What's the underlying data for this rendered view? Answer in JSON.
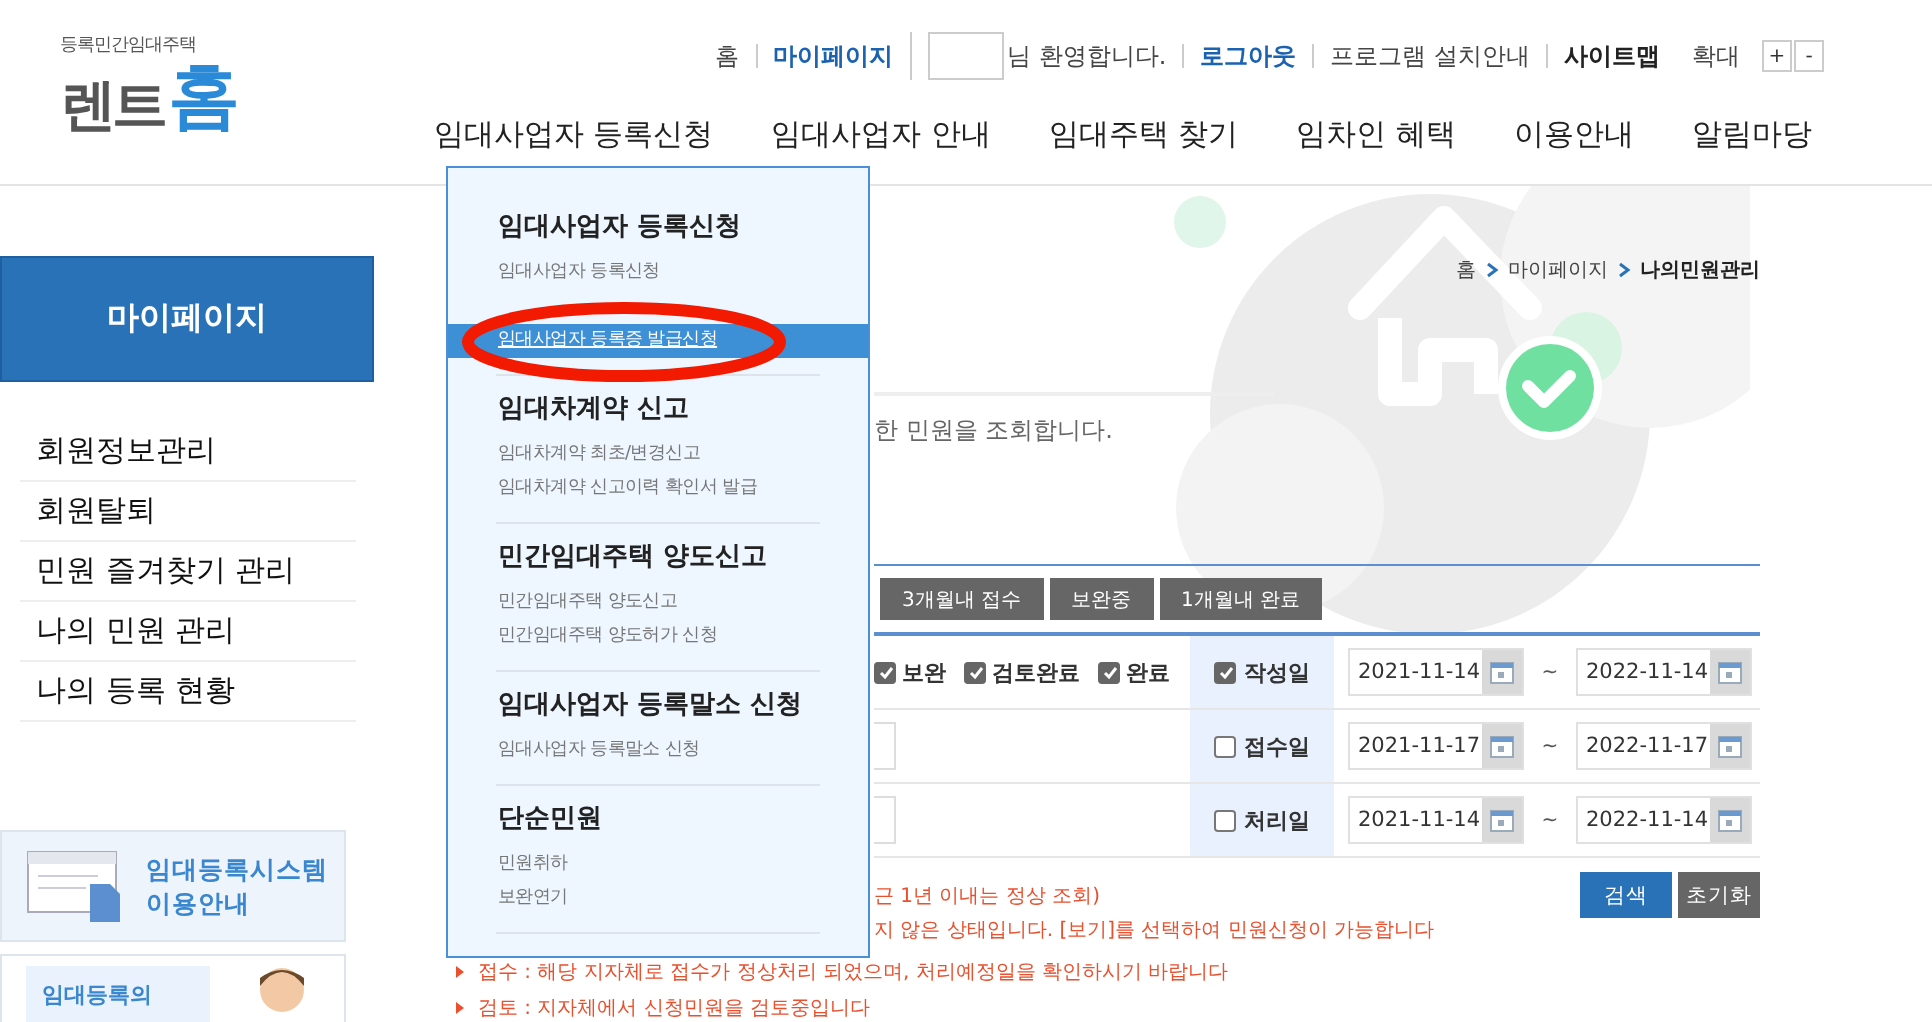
{
  "header": {
    "logo": {
      "subtitle": "등록민간임대주택",
      "name_main": "렌트",
      "name_accent": "홈"
    },
    "utility_links": [
      {
        "label": "홈",
        "kind": "plain"
      },
      {
        "label": "마이페이지",
        "kind": "accent"
      },
      {
        "label": "님 환영합니다.",
        "kind": "welcome"
      },
      {
        "label": "로그아웃",
        "kind": "accent"
      },
      {
        "label": "프로그램 설치안내",
        "kind": "plain"
      },
      {
        "label": "사이트맵",
        "kind": "bold"
      }
    ],
    "zoom": {
      "label": "확대",
      "buttons": [
        "+",
        "-"
      ]
    },
    "nav": [
      "임대사업자 등록신청",
      "임대사업자 안내",
      "임대주택 찾기",
      "임차인 혜택",
      "이용안내",
      "알림마당"
    ]
  },
  "mega_menu": [
    {
      "heading": "임대사업자 등록신청",
      "items": [
        {
          "label": "임대사업자 등록신청",
          "selected": false
        },
        {
          "label": "임대사업자 등록증 발급신청",
          "selected": true
        }
      ]
    },
    {
      "heading": "임대차계약 신고",
      "items": [
        {
          "label": "임대차계약 최초/변경신고",
          "selected": false
        },
        {
          "label": "임대차계약 신고이력 확인서 발급",
          "selected": false
        }
      ]
    },
    {
      "heading": "민간임대주택 양도신고",
      "items": [
        {
          "label": "민간임대주택 양도신고",
          "selected": false
        },
        {
          "label": "민간임대주택 양도허가 신청",
          "selected": false
        }
      ]
    },
    {
      "heading": "임대사업자 등록말소 신청",
      "items": [
        {
          "label": "임대사업자 등록말소 신청",
          "selected": false
        }
      ]
    },
    {
      "heading": "단순민원",
      "items": [
        {
          "label": "민원취하",
          "selected": false
        },
        {
          "label": "보완연기",
          "selected": false
        }
      ]
    }
  ],
  "sidebar": {
    "title": "마이페이지",
    "items": [
      {
        "label": "회원정보관리",
        "selected": false
      },
      {
        "label": "회원탈퇴",
        "selected": false
      },
      {
        "label": "민원 즐겨찾기 관리",
        "selected": false
      },
      {
        "label": "나의 민원 관리",
        "selected": false
      },
      {
        "label": "나의 등록 현황",
        "selected": false
      }
    ],
    "banners": [
      {
        "kind": "guide",
        "lines": [
          "임대등록시스템",
          "이용안내"
        ]
      },
      {
        "kind": "person",
        "lines": [
          "임대등록의"
        ]
      }
    ]
  },
  "main": {
    "breadcrumb": [
      {
        "label": "홈",
        "current": false
      },
      {
        "label": "마이페이지",
        "current": false
      },
      {
        "label": "나의민원관리",
        "current": true
      }
    ],
    "description": "한 민원을 조회합니다.",
    "filter_buttons": [
      "3개월내 접수",
      "보완중",
      "1개월내 완료"
    ],
    "rows": [
      {
        "statuses": [
          {
            "label": "보완",
            "checked": true
          },
          {
            "label": "검토완료",
            "checked": true
          },
          {
            "label": "완료",
            "checked": true
          }
        ],
        "date_label": "작성일",
        "checked": true,
        "from": "2021-11-14",
        "to": "2022-11-14",
        "separator": "~"
      },
      {
        "field": true,
        "date_label": "접수일",
        "checked": false,
        "from": "2021-11-17",
        "to": "2022-11-17",
        "separator": "~"
      },
      {
        "field": true,
        "date_label": "처리일",
        "checked": false,
        "from": "2021-11-14",
        "to": "2022-11-14",
        "separator": "~"
      }
    ],
    "actions": [
      {
        "label": "검색",
        "kind": "primary"
      },
      {
        "label": "초기화",
        "kind": "secondary"
      }
    ],
    "notes": [
      {
        "text": "근 1년 이내는 정상 조회)",
        "kind": "partial"
      },
      {
        "text": "지 않은 상태입니다. [보기]를 선택하여 민원신청이 가능합니다",
        "kind": "partial"
      },
      {
        "text": "접수 : 해당 지자체로 접수가 정상처리 되었으며, 처리예정일을 확인하시기 바랍니다",
        "kind": "bullet"
      },
      {
        "text": "검토 : 지자체에서 신청민원을 검토중입니다",
        "kind": "bullet"
      }
    ]
  }
}
